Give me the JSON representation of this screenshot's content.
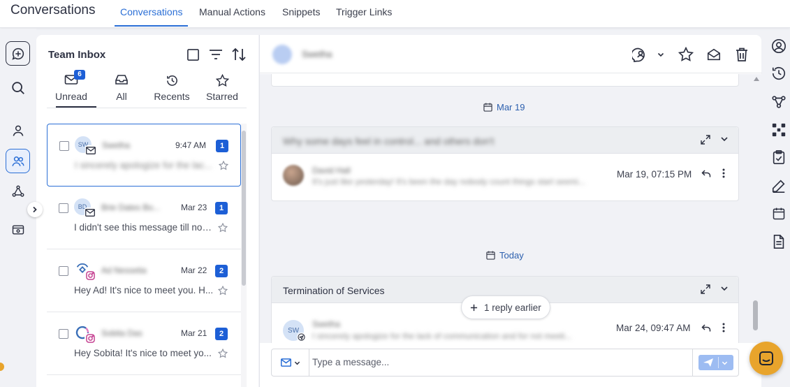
{
  "app": {
    "title": "Conversations"
  },
  "nav_tabs": [
    {
      "label": "Conversations",
      "active": true
    },
    {
      "label": "Manual Actions"
    },
    {
      "label": "Snippets"
    },
    {
      "label": "Trigger Links"
    }
  ],
  "left_rail": {
    "icons": [
      "compose-icon",
      "search-icon",
      "contact-icon",
      "team-icon",
      "flow-icon",
      "preview-icon"
    ]
  },
  "inbox": {
    "title": "Team Inbox",
    "filter_tabs": [
      {
        "label": "Unread",
        "badge": "6",
        "active": true
      },
      {
        "label": "All"
      },
      {
        "label": "Recents"
      },
      {
        "label": "Starred"
      }
    ],
    "conversations": [
      {
        "initials": "SW",
        "name": "Swetha",
        "time": "9:47 AM",
        "unread": "1",
        "preview": "I sincerely apologize for the lac...",
        "channel": "email",
        "selected": true
      },
      {
        "initials": "BD",
        "name": "Brie Dates Bo...",
        "time": "Mar 23",
        "unread": "1",
        "preview": "I didn't see this message till now...",
        "channel": "email"
      },
      {
        "initials": "",
        "name": "Ad Nessetia",
        "time": "Mar 22",
        "unread": "2",
        "preview": "Hey Ad! It's nice to meet you. H...",
        "channel": "instagram"
      },
      {
        "initials": "",
        "name": "Sobita Das",
        "time": "Mar 21",
        "unread": "2",
        "preview": "Hey Sobita! It's nice to meet yo...",
        "channel": "instagram"
      }
    ]
  },
  "thread": {
    "contact_name": "Swetha",
    "date_chips": [
      "Mar 19",
      "Today"
    ],
    "groups": [
      {
        "subject": "Why some days feel in control... and others don't",
        "message": {
          "sender": "David Hall",
          "text": "It's just like yesterday! It's been the day nobody count things start seemi...",
          "time": "Mar 19, 07:15 PM"
        }
      },
      {
        "subject": "Termination of Services",
        "message": {
          "initials": "SW",
          "sender": "Swetha",
          "text": "I sincerely apologize for the lack of communication and for not meeti...",
          "time": "Mar 24, 09:47 AM"
        }
      }
    ],
    "reply_earlier": "1 reply earlier",
    "composer": {
      "placeholder": "Type a message..."
    }
  },
  "colors": {
    "accent": "#2b6fd6",
    "badge": "#1d5fd6",
    "chat_button": "#e8a42c"
  }
}
